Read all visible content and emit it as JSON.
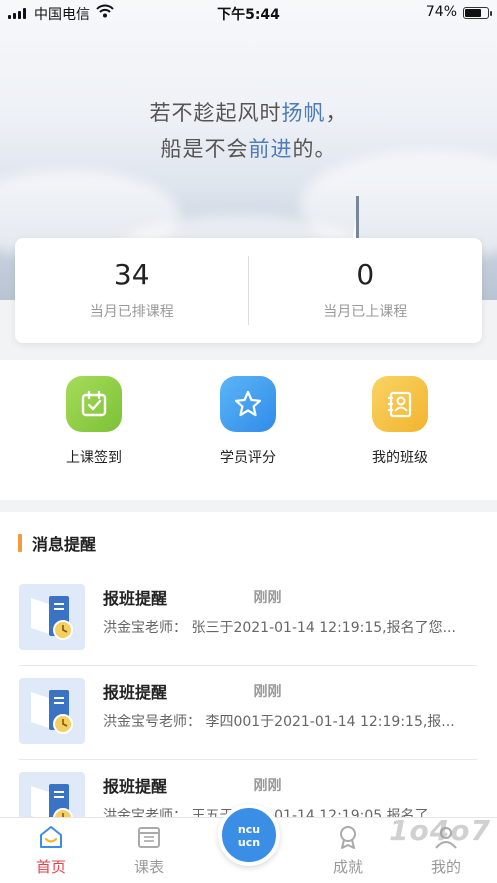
{
  "status_bar": {
    "carrier": "中国电信",
    "time": "下午5:44",
    "battery": "74%",
    "battery_level": 0.74
  },
  "hero": {
    "line1": [
      "若不趁起风时",
      "扬帆",
      "，"
    ],
    "line2": [
      "船是不会",
      "前进",
      "的。"
    ]
  },
  "stats": [
    {
      "value": "34",
      "label": "当月已排课程"
    },
    {
      "value": "0",
      "label": "当月已上课程"
    }
  ],
  "actions": [
    {
      "label": "上课签到",
      "icon": "calendar-check-icon",
      "color": "#8ccb3f"
    },
    {
      "label": "学员评分",
      "icon": "star-icon",
      "color": "#3c9ef2"
    },
    {
      "label": "我的班级",
      "icon": "class-card-icon",
      "color": "#f5c242"
    }
  ],
  "messages": {
    "title": "消息提醒",
    "items": [
      {
        "title": "报班提醒",
        "time": "刚刚",
        "body": "洪金宝老师：  张三于2021-01-14 12:19:15,报名了您..."
      },
      {
        "title": "报班提醒",
        "time": "刚刚",
        "body": "洪金宝号老师：  李四001于2021-01-14 12:19:15,报..."
      },
      {
        "title": "报班提醒",
        "time": "刚刚",
        "body": "洪金宝老师：  王五于2021-01-14 12:19:05,报名了..."
      }
    ]
  },
  "tabbar": {
    "tabs": [
      {
        "label": "首页",
        "icon": "home-icon",
        "active": true
      },
      {
        "label": "课表",
        "icon": "calendar-icon",
        "active": false
      },
      {
        "label": "成就",
        "icon": "achievement-icon",
        "active": false
      },
      {
        "label": "我的",
        "icon": "profile-icon",
        "active": false
      }
    ],
    "center_icon": "app-logo-icon"
  },
  "watermark": "1o4o7"
}
